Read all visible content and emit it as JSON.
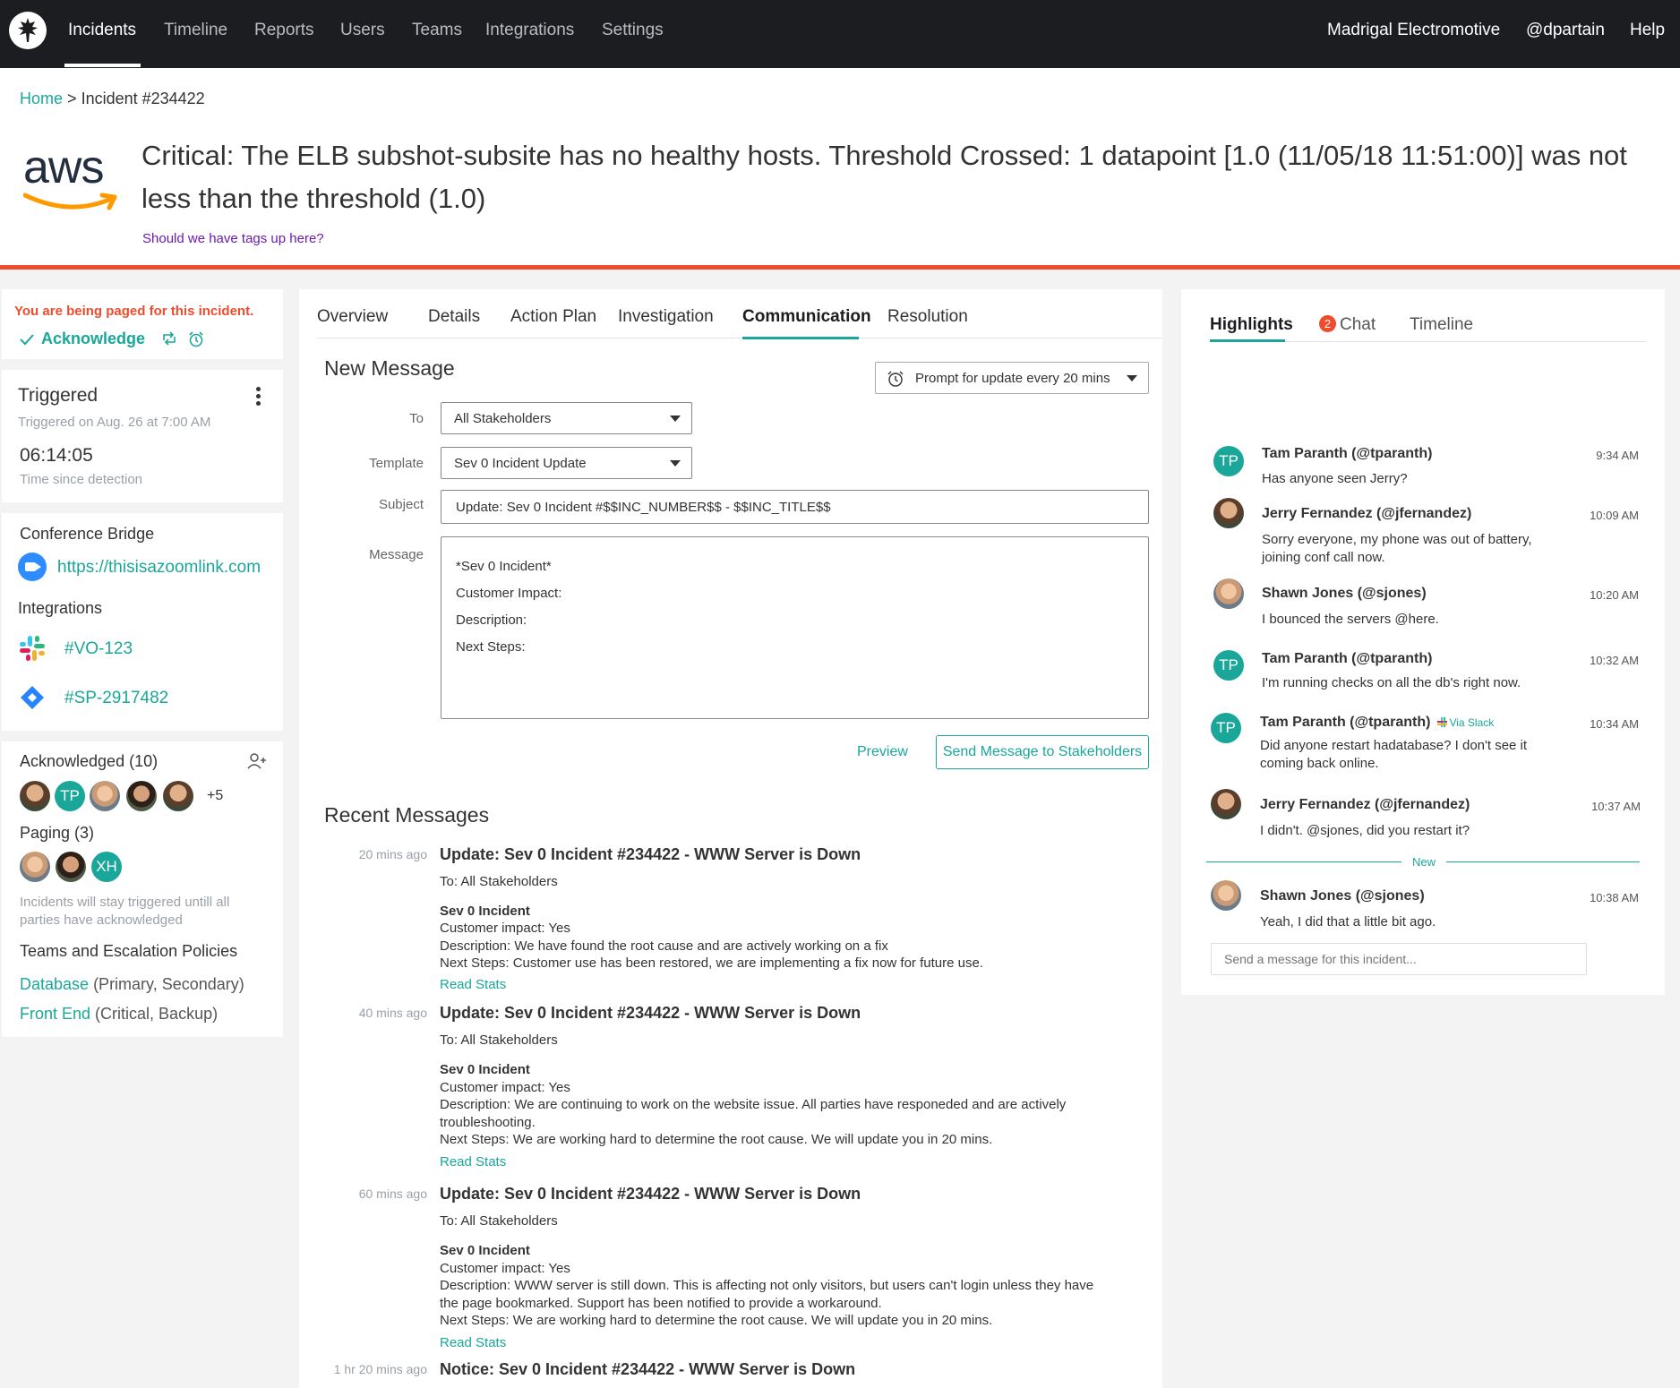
{
  "nav": {
    "items": [
      "Incidents",
      "Timeline",
      "Reports",
      "Users",
      "Teams",
      "Integrations",
      "Settings"
    ],
    "org": "Madrigal Electromotive",
    "user": "@dpartain",
    "help": "Help"
  },
  "breadcrumb": {
    "home": "Home",
    "separator": ">",
    "current": "Incident #234422"
  },
  "incident": {
    "logo_text": "aws",
    "title": "Critical: The ELB subshot-subsite has no healthy hosts. Threshold Crossed: 1 datapoint [1.0 (11/05/18 11:51:00)] was not less than the threshold (1.0)",
    "tags_prompt": "Should we have tags up here?"
  },
  "left": {
    "paged": "You are being paged for this incident.",
    "acknowledge": "Acknowledge",
    "status": "Triggered",
    "triggered_on": "Triggered on Aug. 26 at 7:00 AM",
    "timer": "06:14:05",
    "timer_label": "Time since detection",
    "conference_bridge": "Conference Bridge",
    "zoom_link": "https://thisisazoomlink.com",
    "integrations_label": "Integrations",
    "slack_channel": "#VO-123",
    "jira_ticket": "#SP-2917482",
    "acknowledged": "Acknowledged (10)",
    "ack_initials": "TP",
    "ack_more": "+5",
    "paging": "Paging (3)",
    "paging_initials": "XH",
    "paging_note": "Incidents will stay triggered untill all parties have acknowledged",
    "teams_label": "Teams and Escalation Policies",
    "teams": [
      {
        "name": "Database",
        "policies": " (Primary, Secondary)"
      },
      {
        "name": "Front End",
        "policies": " (Critical, Backup)"
      }
    ]
  },
  "tabs": [
    "Overview",
    "Details",
    "Action Plan",
    "Investigation",
    "Communication",
    "Resolution"
  ],
  "compose": {
    "heading": "New Message",
    "prompt": "Prompt for update every 20 mins",
    "to_label": "To",
    "to_value": "All Stakeholders",
    "template_label": "Template",
    "template_value": "Sev 0 Incident Update",
    "subject_label": "Subject",
    "subject_value": "Update: Sev 0 Incident #$$INC_NUMBER$$ - $$INC_TITLE$$",
    "message_label": "Message",
    "message_lines": [
      "*Sev 0 Incident*",
      "Customer Impact:",
      "Description:",
      "Next Steps:"
    ],
    "preview": "Preview",
    "send": "Send Message to Stakeholders"
  },
  "recent": {
    "heading": "Recent Messages",
    "messages": [
      {
        "time": "20 mins ago",
        "title": "Update: Sev 0 Incident #234422 - WWW Server is Down",
        "to": "To: All Stakeholders",
        "severity": "Sev 0 Incident",
        "impact": "Customer impact: Yes",
        "description": [
          "Description: We have found the root cause and are actively working on a fix"
        ],
        "next": "Next Steps: Customer use has been restored, we are implementing a fix now for future use.",
        "read_stats": "Read Stats"
      },
      {
        "time": "40 mins ago",
        "title": "Update: Sev 0 Incident #234422 - WWW Server is Down",
        "to": "To: All Stakeholders",
        "severity": "Sev 0 Incident",
        "impact": "Customer impact: Yes",
        "description": [
          "Description: We are continuing to work on the website issue. All parties have responeded and are actively",
          "troubleshooting."
        ],
        "next": "Next Steps: We are working hard to determine the root cause. We will update you in 20 mins.",
        "read_stats": "Read Stats"
      },
      {
        "time": "60 mins ago",
        "title": "Update: Sev 0 Incident #234422 - WWW Server is Down",
        "to": "To: All Stakeholders",
        "severity": "Sev 0 Incident",
        "impact": "Customer impact: Yes",
        "description": [
          "Description: WWW server is still down. This is affecting not only visitors, but users can't login unless they have",
          "the page bookmarked. Support has been notified to provide a workaround."
        ],
        "next": "Next Steps: We are working hard to determine the root cause. We will update you in 20 mins.",
        "read_stats": "Read Stats"
      },
      {
        "time": "1 hr 20 mins ago",
        "title": "Notice: Sev 0 Incident #234422 - WWW Server is Down"
      }
    ]
  },
  "right": {
    "tabs": [
      "Highlights",
      "Chat",
      "Timeline"
    ],
    "chat_badge": "2",
    "via_slack": "Via Slack",
    "new_label": "New",
    "input_placeholder": "Send a message for this incident...",
    "chats": [
      {
        "initials": "TP",
        "name": "Tam Paranth (@tparanth)",
        "time": "9:34 AM",
        "text": "Has anyone seen Jerry?"
      },
      {
        "name": "Jerry Fernandez (@jfernandez)",
        "time": "10:09 AM",
        "text": "Sorry everyone, my phone was out of battery, joining conf call now."
      },
      {
        "name": "Shawn Jones (@sjones)",
        "time": "10:20 AM",
        "text": "I bounced the servers @here."
      },
      {
        "initials": "TP",
        "name": "Tam Paranth (@tparanth)",
        "time": "10:32 AM",
        "text": "I'm running checks on all the db's right now."
      },
      {
        "initials": "TP",
        "name": "Tam Paranth (@tparanth)",
        "time": "10:34 AM",
        "text": "Did anyone restart hadatabase? I don't see it coming back online."
      },
      {
        "name": "Jerry Fernandez (@jfernandez)",
        "time": "10:37 AM",
        "text": "I didn't. @sjones, did you restart it?"
      },
      {
        "name": "Shawn Jones (@sjones)",
        "time": "10:38 AM",
        "text": "Yeah, I did that a little bit ago."
      }
    ]
  },
  "colors": {
    "accent": "#1aa79a",
    "alert": "#ee4d2d",
    "nav_bg": "#1c1d20",
    "tags_link": "#6a1bb0"
  }
}
